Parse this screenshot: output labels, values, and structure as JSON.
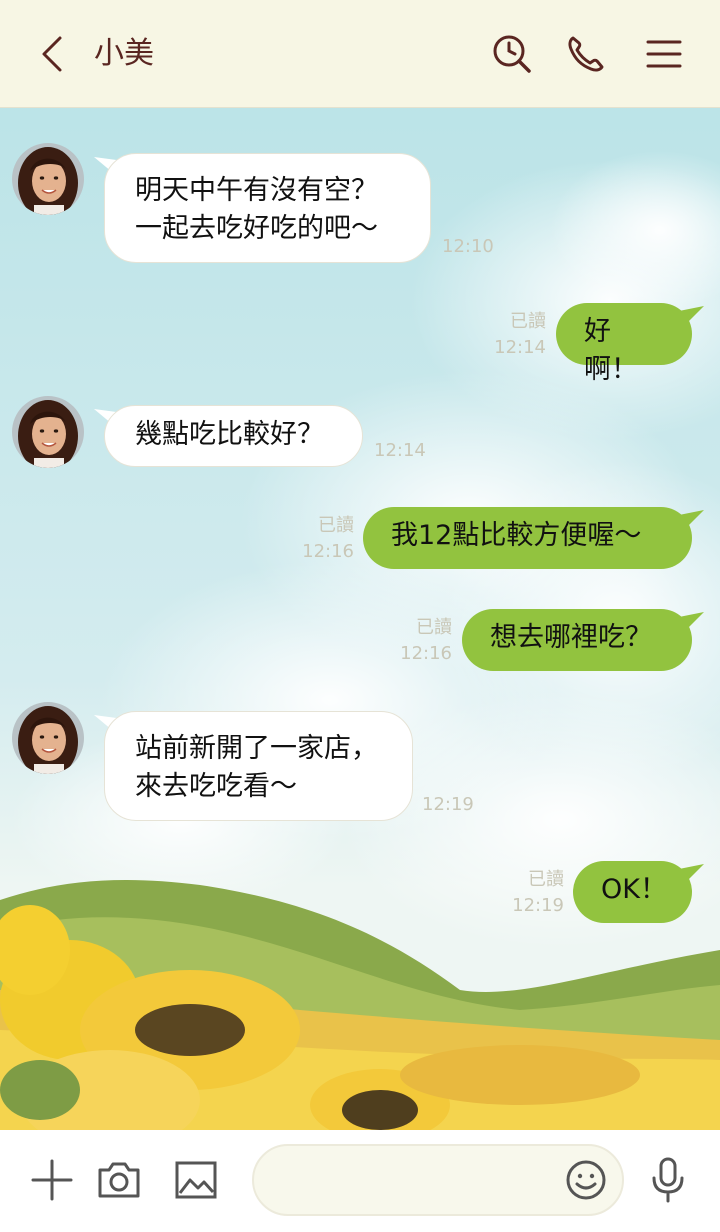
{
  "header": {
    "contact_name": "小美",
    "icons": [
      "back-icon",
      "search-icon",
      "phone-icon",
      "menu-icon"
    ]
  },
  "messages": [
    {
      "side": "in",
      "lines": [
        "明天中午有沒有空？",
        "一起去吃好吃的吧～"
      ],
      "time": "12:10"
    },
    {
      "side": "out",
      "text": "好啊！",
      "read": "已讀",
      "time": "12:14"
    },
    {
      "side": "in",
      "lines": [
        "幾點吃比較好？"
      ],
      "time": "12:14"
    },
    {
      "side": "out",
      "text": "我12點比較方便喔～",
      "read": "已讀",
      "time": "12:16"
    },
    {
      "side": "out",
      "text": "想去哪裡吃？",
      "read": "已讀",
      "time": "12:16"
    },
    {
      "side": "in",
      "lines": [
        "站前新開了一家店，",
        "來去吃吃看～"
      ],
      "time": "12:19"
    },
    {
      "side": "out",
      "text": "OK！",
      "read": "已讀",
      "time": "12:19"
    }
  ],
  "footer": {
    "input_value": "",
    "icons": [
      "plus-icon",
      "camera-icon",
      "image-icon",
      "emoji-icon",
      "microphone-icon"
    ]
  },
  "colors": {
    "header_bg": "#f7f6e4",
    "accent_text": "#5a2621",
    "outgoing_bubble": "#92c33f",
    "incoming_bubble": "#ffffff",
    "sky": "#bfe3e6",
    "hills": "#8fae4f",
    "sunflowers": "#f2cc3a"
  }
}
